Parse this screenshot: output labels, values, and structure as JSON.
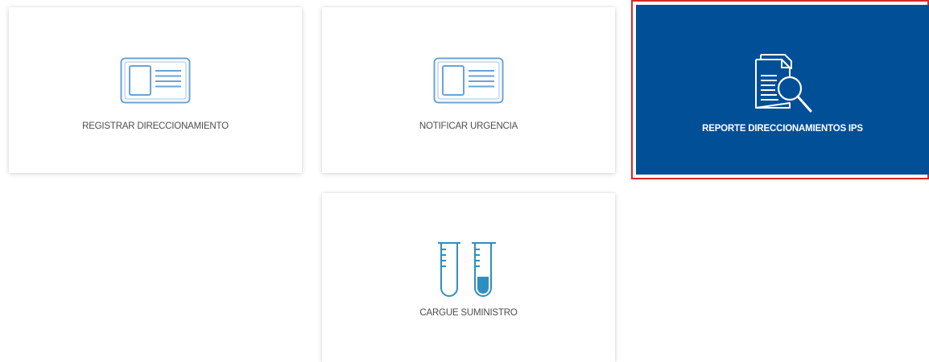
{
  "cards": [
    {
      "label": "REGISTRAR DIRECCIONAMIENTO",
      "icon": "id-card-icon",
      "selected": false
    },
    {
      "label": "NOTIFICAR URGENCIA",
      "icon": "id-card-icon",
      "selected": false
    },
    {
      "label": "REPORTE DIRECCIONAMIENTOS IPS",
      "icon": "document-search-icon",
      "selected": true
    },
    {
      "label": "CARGUE SUMINISTRO",
      "icon": "test-tubes-icon",
      "selected": false
    }
  ],
  "colors": {
    "accent": "#004f97",
    "icon_blue": "#6aa3d8",
    "tube_teal": "#2e8fbf",
    "highlight_border": "#d9262c",
    "label_text": "#4d4d4d"
  }
}
